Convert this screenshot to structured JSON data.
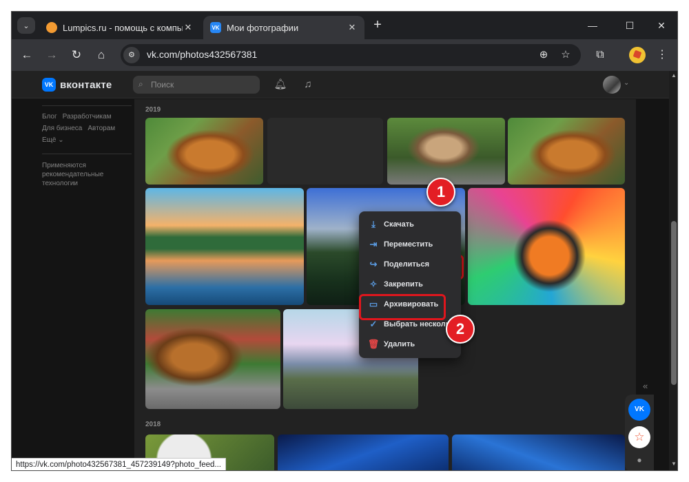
{
  "browser": {
    "tabs": [
      {
        "title": "Lumpics.ru - помощь с компьютером",
        "favicon": "lumpics-favicon",
        "active": false
      },
      {
        "title": "Мои фотографии",
        "favicon": "vk-favicon",
        "active": true
      }
    ],
    "new_tab_label": "+",
    "window_controls": {
      "minimize": "—",
      "maximize": "☐",
      "close": "✕"
    },
    "url": "vk.com/photos432567381",
    "status_url": "https://vk.com/photo432567381_457239149?photo_feed..."
  },
  "vk": {
    "logo_text": "вконтакте",
    "search_placeholder": "Поиск",
    "left_menu": {
      "links_row1": [
        "Блог",
        "Разработчикам"
      ],
      "links_row2": [
        "Для бизнеса",
        "Авторам"
      ],
      "more": "Ещё ⌄",
      "note": "Применяются рекомендательные технологии"
    },
    "years": {
      "first": "2019",
      "second": "2018"
    },
    "photo_menu": {
      "items": [
        {
          "label": "Скачать",
          "icon": "download-icon",
          "glyph": "⤓"
        },
        {
          "label": "Переместить",
          "icon": "move-icon",
          "glyph": "⇥"
        },
        {
          "label": "Поделиться",
          "icon": "share-icon",
          "glyph": "↪"
        },
        {
          "label": "Закрепить",
          "icon": "pin-icon",
          "glyph": "✧"
        },
        {
          "label": "Архивировать",
          "icon": "archive-icon",
          "glyph": "▭"
        },
        {
          "label": "Выбрать несколько",
          "icon": "select-icon",
          "glyph": "✓"
        },
        {
          "label": "Удалить",
          "icon": "delete-icon",
          "glyph": "🗑"
        }
      ]
    },
    "more_button_glyph": "•••"
  },
  "annotations": {
    "badge1": "1",
    "badge2": "2",
    "highlight_color": "#e0161d"
  },
  "colors": {
    "vk_blue": "#0077ff",
    "menu_bg": "#2c2c2e",
    "page_bg": "#141414"
  }
}
